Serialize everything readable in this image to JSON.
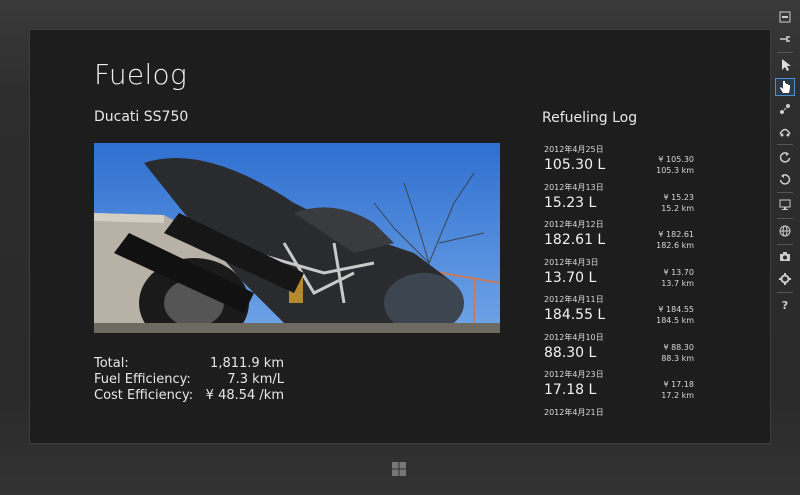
{
  "app": {
    "title": "Fuelog",
    "bike_name": "Ducati SS750"
  },
  "stats": [
    {
      "label": "Total:",
      "value": "1,811.9 km"
    },
    {
      "label": "Fuel Efficiency:",
      "value": "7.3 km/L"
    },
    {
      "label": "Cost Efficiency:",
      "value": "¥ 48.54 /km"
    }
  ],
  "refueling_log": {
    "title": "Refueling Log",
    "entries": [
      {
        "date": "2012年4月25日",
        "amount": "105.30 L",
        "cost": "¥ 105.30",
        "distance": "105.3 km"
      },
      {
        "date": "2012年4月13日",
        "amount": "15.23 L",
        "cost": "¥ 15.23",
        "distance": "15.2 km"
      },
      {
        "date": "2012年4月12日",
        "amount": "182.61 L",
        "cost": "¥ 182.61",
        "distance": "182.6 km"
      },
      {
        "date": "2012年4月3日",
        "amount": "13.70 L",
        "cost": "¥ 13.70",
        "distance": "13.7 km"
      },
      {
        "date": "2012年4月11日",
        "amount": "184.55 L",
        "cost": "¥ 184.55",
        "distance": "184.5 km"
      },
      {
        "date": "2012年4月10日",
        "amount": "88.30 L",
        "cost": "¥ 88.30",
        "distance": "88.3 km"
      },
      {
        "date": "2012年4月23日",
        "amount": "17.18 L",
        "cost": "¥ 17.18",
        "distance": "17.2 km"
      },
      {
        "date": "2012年4月21日",
        "amount": "",
        "cost": "",
        "distance": ""
      }
    ]
  },
  "toolbar": {
    "tools": [
      "minimize-icon",
      "pin-icon",
      "pointer-icon",
      "touch-hand-icon",
      "pinch-zoom-icon",
      "swipe-icon",
      "rotate-clockwise-icon",
      "rotate-counterclockwise-icon",
      "screen-resolution-icon",
      "location-globe-icon",
      "screenshot-camera-icon",
      "settings-gear-icon",
      "help-icon"
    ],
    "help_label": "?"
  },
  "colors": {
    "accent": "#4a8fd8",
    "background": "#1d1d1d"
  }
}
